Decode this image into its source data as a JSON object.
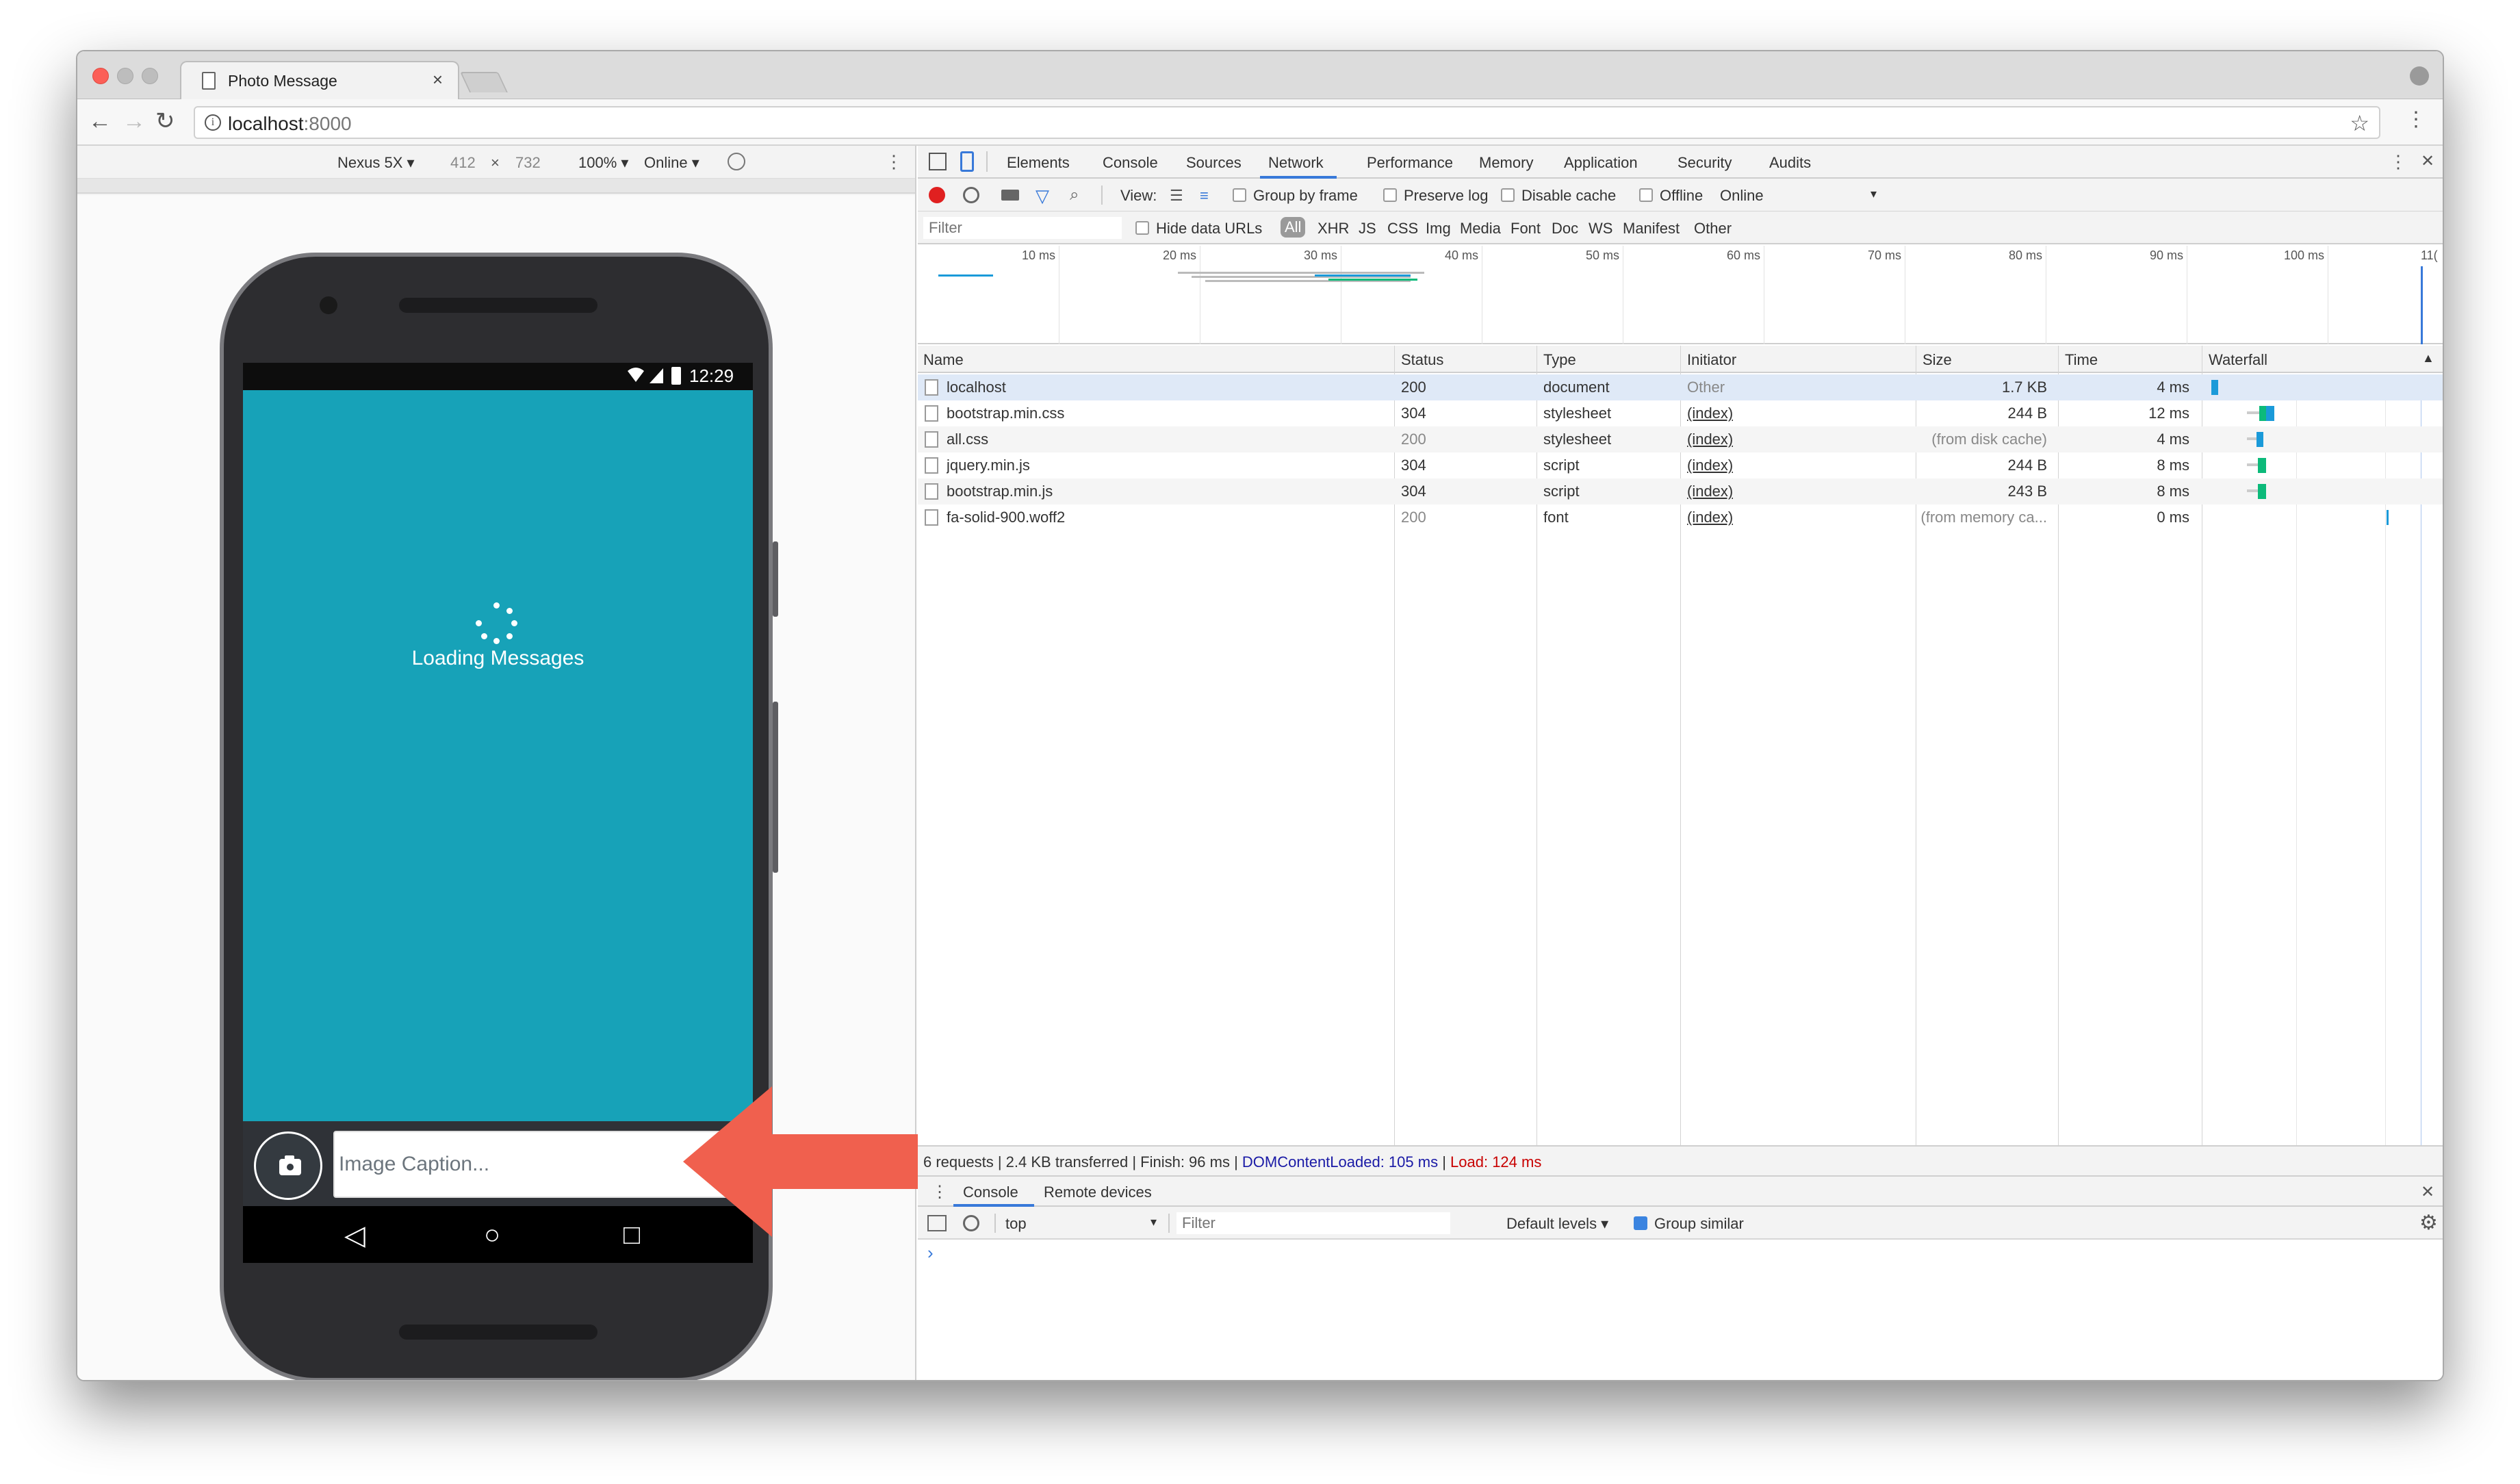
{
  "browser": {
    "tab_title": "Photo Message",
    "tab_close": "×",
    "url_host": "localhost",
    "url_port": ":8000",
    "info_glyph": "i",
    "back_glyph": "←",
    "forward_glyph": "→",
    "reload_glyph": "↻",
    "star_glyph": "☆",
    "menu_glyph": "⋮"
  },
  "device_toolbar": {
    "device": "Nexus 5X ▾",
    "width": "412",
    "times": "×",
    "height": "732",
    "zoom": "100% ▾",
    "throttle": "Online ▾",
    "more": "⋮"
  },
  "phone": {
    "status_time": "12:29",
    "loading_text": "Loading Messages",
    "caption_placeholder": "Image Caption...",
    "nav_back": "◁",
    "nav_home": "○",
    "nav_recent": "□"
  },
  "devtools": {
    "tabs": [
      "Elements",
      "Console",
      "Sources",
      "Network",
      "Performance",
      "Memory",
      "Application",
      "Security",
      "Audits"
    ],
    "active_tab": "Network",
    "more": "⋮",
    "close": "✕",
    "network_toolbar": {
      "view_label": "View:",
      "group_by_frame": "Group by frame",
      "preserve_log": "Preserve log",
      "disable_cache": "Disable cache",
      "offline": "Offline",
      "online": "Online",
      "online_arrow": "▾"
    },
    "filter_bar": {
      "placeholder": "Filter",
      "hide_data_urls": "Hide data URLs",
      "types": [
        "All",
        "XHR",
        "JS",
        "CSS",
        "Img",
        "Media",
        "Font",
        "Doc",
        "WS",
        "Manifest",
        "Other"
      ]
    },
    "overview_ticks": [
      "10 ms",
      "20 ms",
      "30 ms",
      "40 ms",
      "50 ms",
      "60 ms",
      "70 ms",
      "80 ms",
      "90 ms",
      "100 ms",
      "11("
    ],
    "columns": [
      "Name",
      "Status",
      "Type",
      "Initiator",
      "Size",
      "Time",
      "Waterfall"
    ],
    "sort_indicator": "▲",
    "rows": [
      {
        "name": "localhost",
        "status": "200",
        "type": "document",
        "initiator": "Other",
        "size": "1.7 KB",
        "time": "4 ms"
      },
      {
        "name": "bootstrap.min.css",
        "status": "304",
        "type": "stylesheet",
        "initiator": "(index)",
        "size": "244 B",
        "time": "12 ms"
      },
      {
        "name": "all.css",
        "status": "200",
        "type": "stylesheet",
        "initiator": "(index)",
        "size": "(from disk cache)",
        "time": "4 ms"
      },
      {
        "name": "jquery.min.js",
        "status": "304",
        "type": "script",
        "initiator": "(index)",
        "size": "244 B",
        "time": "8 ms"
      },
      {
        "name": "bootstrap.min.js",
        "status": "304",
        "type": "script",
        "initiator": "(index)",
        "size": "243 B",
        "time": "8 ms"
      },
      {
        "name": "fa-solid-900.woff2",
        "status": "200",
        "type": "font",
        "initiator": "(index)",
        "size": "(from memory ca...",
        "time": "0 ms"
      }
    ],
    "summary": {
      "main": "6 requests | 2.4 KB transferred | Finish: 96 ms | ",
      "dom": "DOMContentLoaded: 105 ms",
      "sep": " | ",
      "load": "Load: 124 ms"
    },
    "drawer": {
      "tabs": [
        "Console",
        "Remote devices"
      ],
      "context": "top",
      "context_arrow": "▾",
      "filter_placeholder": "Filter",
      "levels": "Default levels ▾",
      "group_similar": "Group similar",
      "prompt": "›",
      "gear": "⚙"
    }
  },
  "colors": {
    "app_bg": "#17a2b8",
    "arrow": "#f0604e",
    "dom_loaded": "#1a1aa6",
    "load": "#c80000",
    "record": "#e02020"
  }
}
